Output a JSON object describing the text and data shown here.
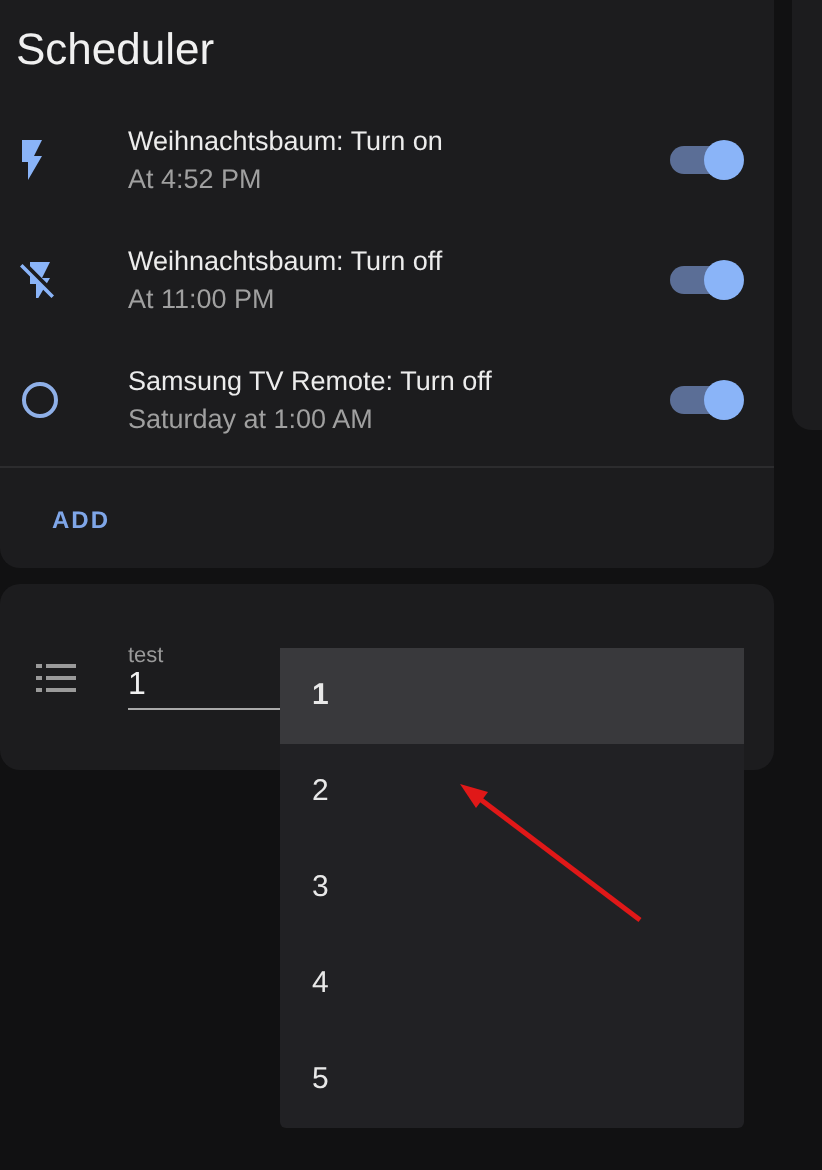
{
  "scheduler": {
    "title": "Scheduler",
    "items": [
      {
        "kind": "flash",
        "title": "Weihnachtsbaum: Turn on",
        "time": "At 4:52 PM",
        "on": true
      },
      {
        "kind": "flash-off",
        "title": "Weihnachtsbaum: Turn off",
        "time": "At 11:00 PM",
        "on": true
      },
      {
        "kind": "circle",
        "title": "Samsung TV Remote: Turn off",
        "time": "Saturday at 1:00 AM",
        "on": true
      }
    ],
    "add_button": "ADD"
  },
  "input_card": {
    "label": "test",
    "value": "1"
  },
  "dropdown": {
    "options": [
      {
        "label": "1",
        "selected": true
      },
      {
        "label": "2",
        "selected": false
      },
      {
        "label": "3",
        "selected": false
      },
      {
        "label": "4",
        "selected": false
      },
      {
        "label": "5",
        "selected": false
      }
    ]
  }
}
